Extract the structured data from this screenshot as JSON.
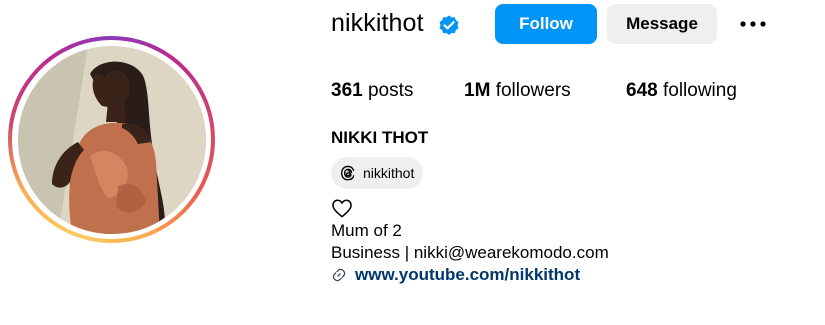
{
  "profile": {
    "username": "nikkithot",
    "full_name": "NIKKI THOT",
    "verified_icon": "verified-badge-icon",
    "verified_color": "#0095f6"
  },
  "actions": {
    "follow_label": "Follow",
    "message_label": "Message",
    "more_icon": "more-options-icon"
  },
  "stats": {
    "posts_count": "361",
    "posts_label": "posts",
    "followers_count": "1M",
    "followers_label": "followers",
    "following_count": "648",
    "following_label": "following"
  },
  "threads": {
    "icon": "threads-icon",
    "handle": "nikkithot"
  },
  "bio": {
    "heart_icon": "heart-icon",
    "line1": "Mum of 2",
    "line2": "Business | nikki@wearekomodo.com"
  },
  "link": {
    "icon": "link-icon",
    "text": "www.youtube.com/nikkithot"
  },
  "colors": {
    "primary_button": "#0095f6",
    "secondary_button": "#efefef",
    "link": "#00376b"
  }
}
